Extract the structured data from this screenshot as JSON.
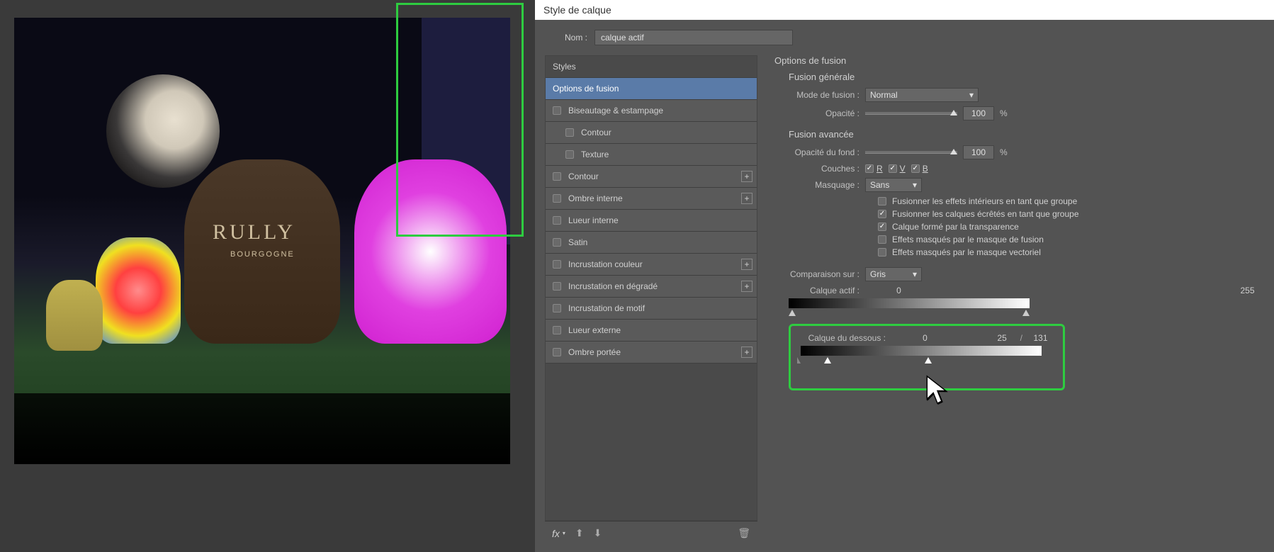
{
  "dialog": {
    "title": "Style de calque",
    "name_label": "Nom :",
    "name_value": "calque actif"
  },
  "styles": {
    "header": "Styles",
    "items": [
      {
        "label": "Options de fusion",
        "active": true,
        "checkbox": false
      },
      {
        "label": "Biseautage & estampage",
        "checkbox": true
      },
      {
        "label": "Contour",
        "checkbox": true,
        "sub": true
      },
      {
        "label": "Texture",
        "checkbox": true,
        "sub": true
      },
      {
        "label": "Contour",
        "checkbox": true,
        "plus": true
      },
      {
        "label": "Ombre interne",
        "checkbox": true,
        "plus": true
      },
      {
        "label": "Lueur interne",
        "checkbox": true
      },
      {
        "label": "Satin",
        "checkbox": true
      },
      {
        "label": "Incrustation couleur",
        "checkbox": true,
        "plus": true
      },
      {
        "label": "Incrustation en dégradé",
        "checkbox": true,
        "plus": true
      },
      {
        "label": "Incrustation de motif",
        "checkbox": true
      },
      {
        "label": "Lueur externe",
        "checkbox": true
      },
      {
        "label": "Ombre portée",
        "checkbox": true,
        "plus": true
      }
    ],
    "footer_fx": "fx"
  },
  "options": {
    "section_title": "Options de fusion",
    "general": {
      "title": "Fusion générale",
      "blend_mode_label": "Mode de fusion :",
      "blend_mode_value": "Normal",
      "opacity_label": "Opacité :",
      "opacity_value": "100",
      "opacity_unit": "%"
    },
    "advanced": {
      "title": "Fusion avancée",
      "fill_label": "Opacité du fond :",
      "fill_value": "100",
      "fill_unit": "%",
      "channels_label": "Couches :",
      "channels": [
        "R",
        "V",
        "B"
      ],
      "knockout_label": "Masquage :",
      "knockout_value": "Sans",
      "opts": [
        {
          "label": "Fusionner les effets intérieurs en tant que groupe",
          "checked": false
        },
        {
          "label": "Fusionner les calques écrêtés en tant que groupe",
          "checked": true
        },
        {
          "label": "Calque formé par la transparence",
          "checked": true
        },
        {
          "label": "Effets masqués par le masque de fusion",
          "checked": false
        },
        {
          "label": "Effets masqués par le masque vectoriel",
          "checked": false
        }
      ]
    },
    "blend_if": {
      "compare_label": "Comparaison sur :",
      "compare_value": "Gris",
      "this_layer_label": "Calque actif :",
      "this_low": "0",
      "this_high": "255",
      "under_layer_label": "Calque du dessous :",
      "under_low": "0",
      "under_mid": "25",
      "under_sep": "/",
      "under_high": "131"
    }
  },
  "image": {
    "balloon_text": "RULLY",
    "balloon_sub": "BOURGOGNE"
  }
}
